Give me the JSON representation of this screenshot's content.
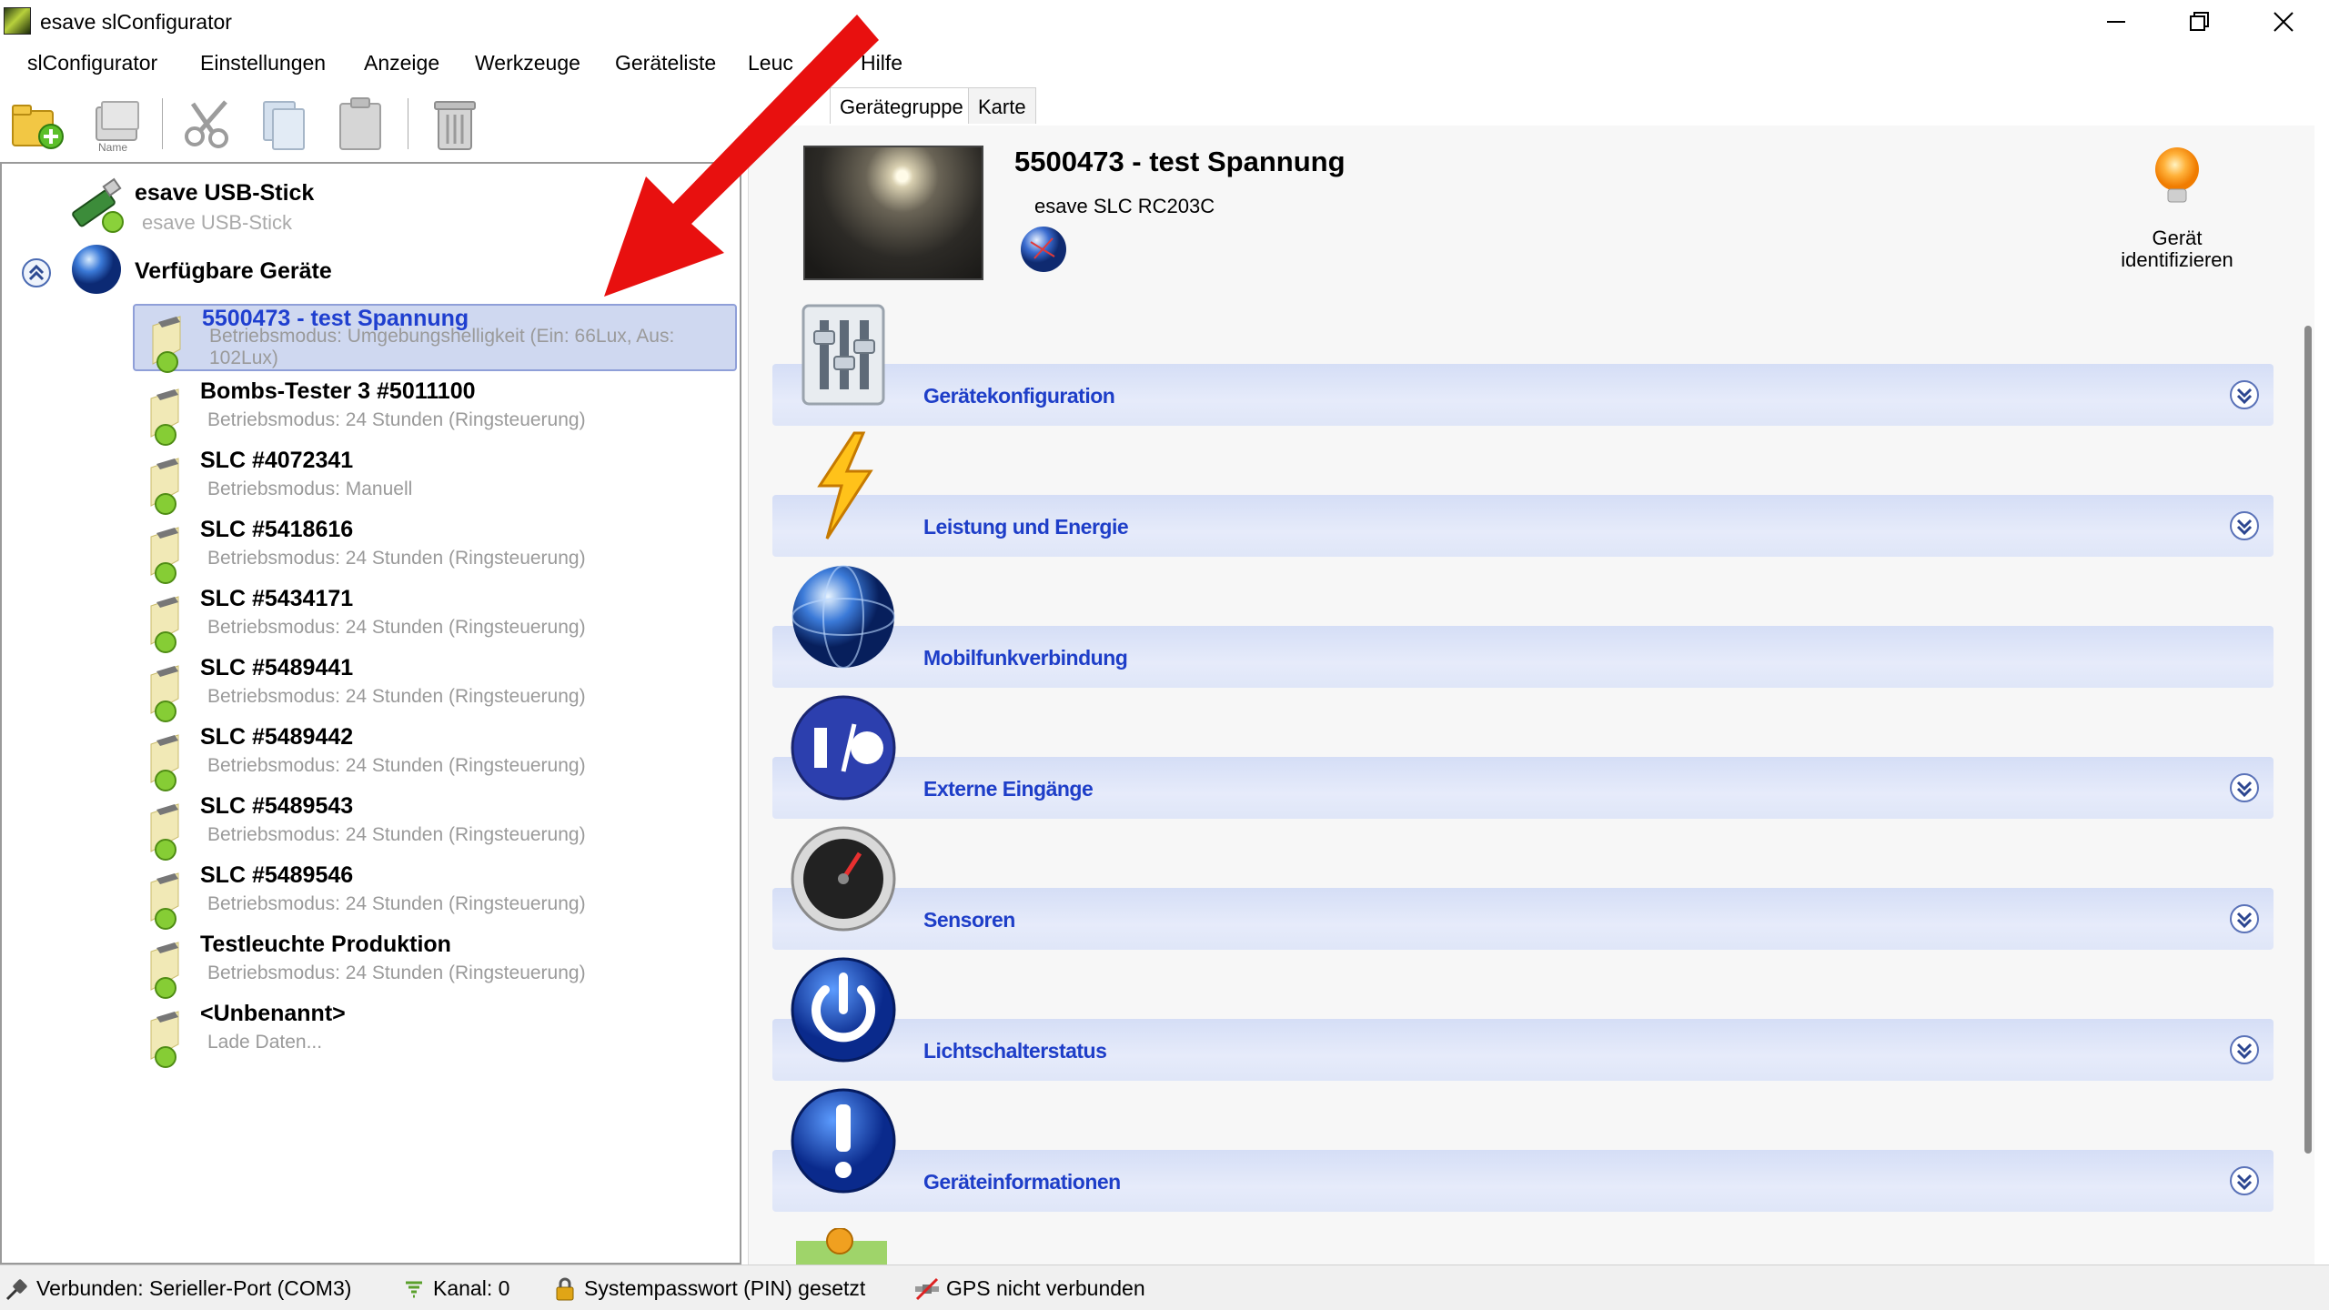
{
  "window": {
    "title": "esave slConfigurator"
  },
  "menu": [
    "slConfigurator",
    "Einstellungen",
    "Anzeige",
    "Werkzeuge",
    "Geräteliste",
    "Leuc",
    "Hilfe"
  ],
  "toolbar": {
    "name_label": "Name"
  },
  "tree": {
    "usb": {
      "title": "esave USB-Stick",
      "subtitle": "esave USB-Stick"
    },
    "available": {
      "title": "Verfügbare Geräte"
    },
    "devices": [
      {
        "name": "5500473 - test  Spannung",
        "mode": "Betriebsmodus: Umgebungshelligkeit (Ein: 66Lux, Aus: 102Lux)",
        "selected": true
      },
      {
        "name": "Bombs-Tester 3 #5011100",
        "mode": "Betriebsmodus: 24 Stunden (Ringsteuerung)"
      },
      {
        "name": "SLC #4072341",
        "mode": "Betriebsmodus: Manuell"
      },
      {
        "name": "SLC #5418616",
        "mode": "Betriebsmodus: 24 Stunden (Ringsteuerung)"
      },
      {
        "name": "SLC #5434171",
        "mode": "Betriebsmodus: 24 Stunden (Ringsteuerung)"
      },
      {
        "name": "SLC #5489441",
        "mode": "Betriebsmodus: 24 Stunden (Ringsteuerung)"
      },
      {
        "name": "SLC #5489442",
        "mode": "Betriebsmodus: 24 Stunden (Ringsteuerung)"
      },
      {
        "name": "SLC #5489543",
        "mode": "Betriebsmodus: 24 Stunden (Ringsteuerung)"
      },
      {
        "name": "SLC #5489546",
        "mode": "Betriebsmodus: 24 Stunden (Ringsteuerung)"
      },
      {
        "name": "Testleuchte Produktion",
        "mode": "Betriebsmodus: 24 Stunden (Ringsteuerung)"
      },
      {
        "name": "<Unbenannt>",
        "mode": "Lade Daten..."
      }
    ]
  },
  "tabs": [
    "Gerätegruppe",
    "Karte"
  ],
  "device": {
    "title": "5500473 - test Spannung",
    "model": "esave SLC RC203C",
    "identify_line1": "Gerät",
    "identify_line2": "identifizieren"
  },
  "sections": [
    {
      "label": "Gerätekonfiguration",
      "icon": "switch-panel-icon",
      "chevron": true
    },
    {
      "label": "Leistung und Energie",
      "icon": "lightning-icon",
      "chevron": true
    },
    {
      "label": "Mobilfunkverbindung",
      "icon": "globe-icon",
      "chevron": false
    },
    {
      "label": "Externe Eingänge",
      "icon": "io-icon",
      "chevron": true
    },
    {
      "label": "Sensoren",
      "icon": "gauge-icon",
      "chevron": true
    },
    {
      "label": "Lichtschalterstatus",
      "icon": "power-icon",
      "chevron": true
    },
    {
      "label": "Geräteinformationen",
      "icon": "info-icon",
      "chevron": true
    }
  ],
  "status": [
    {
      "icon": "plug-icon",
      "text": "Verbunden: Serieller-Port (COM3)"
    },
    {
      "icon": "signal-icon",
      "text": "Kanal: 0"
    },
    {
      "icon": "lock-icon",
      "text": "Systempasswort (PIN) gesetzt"
    },
    {
      "icon": "satellite-off-icon",
      "text": "GPS nicht verbunden"
    }
  ],
  "colors": {
    "accent": "#1e3ec8",
    "section_bar": "#dfe6f8",
    "selection": "#cfd8f0",
    "arrow": "#e8100f"
  }
}
